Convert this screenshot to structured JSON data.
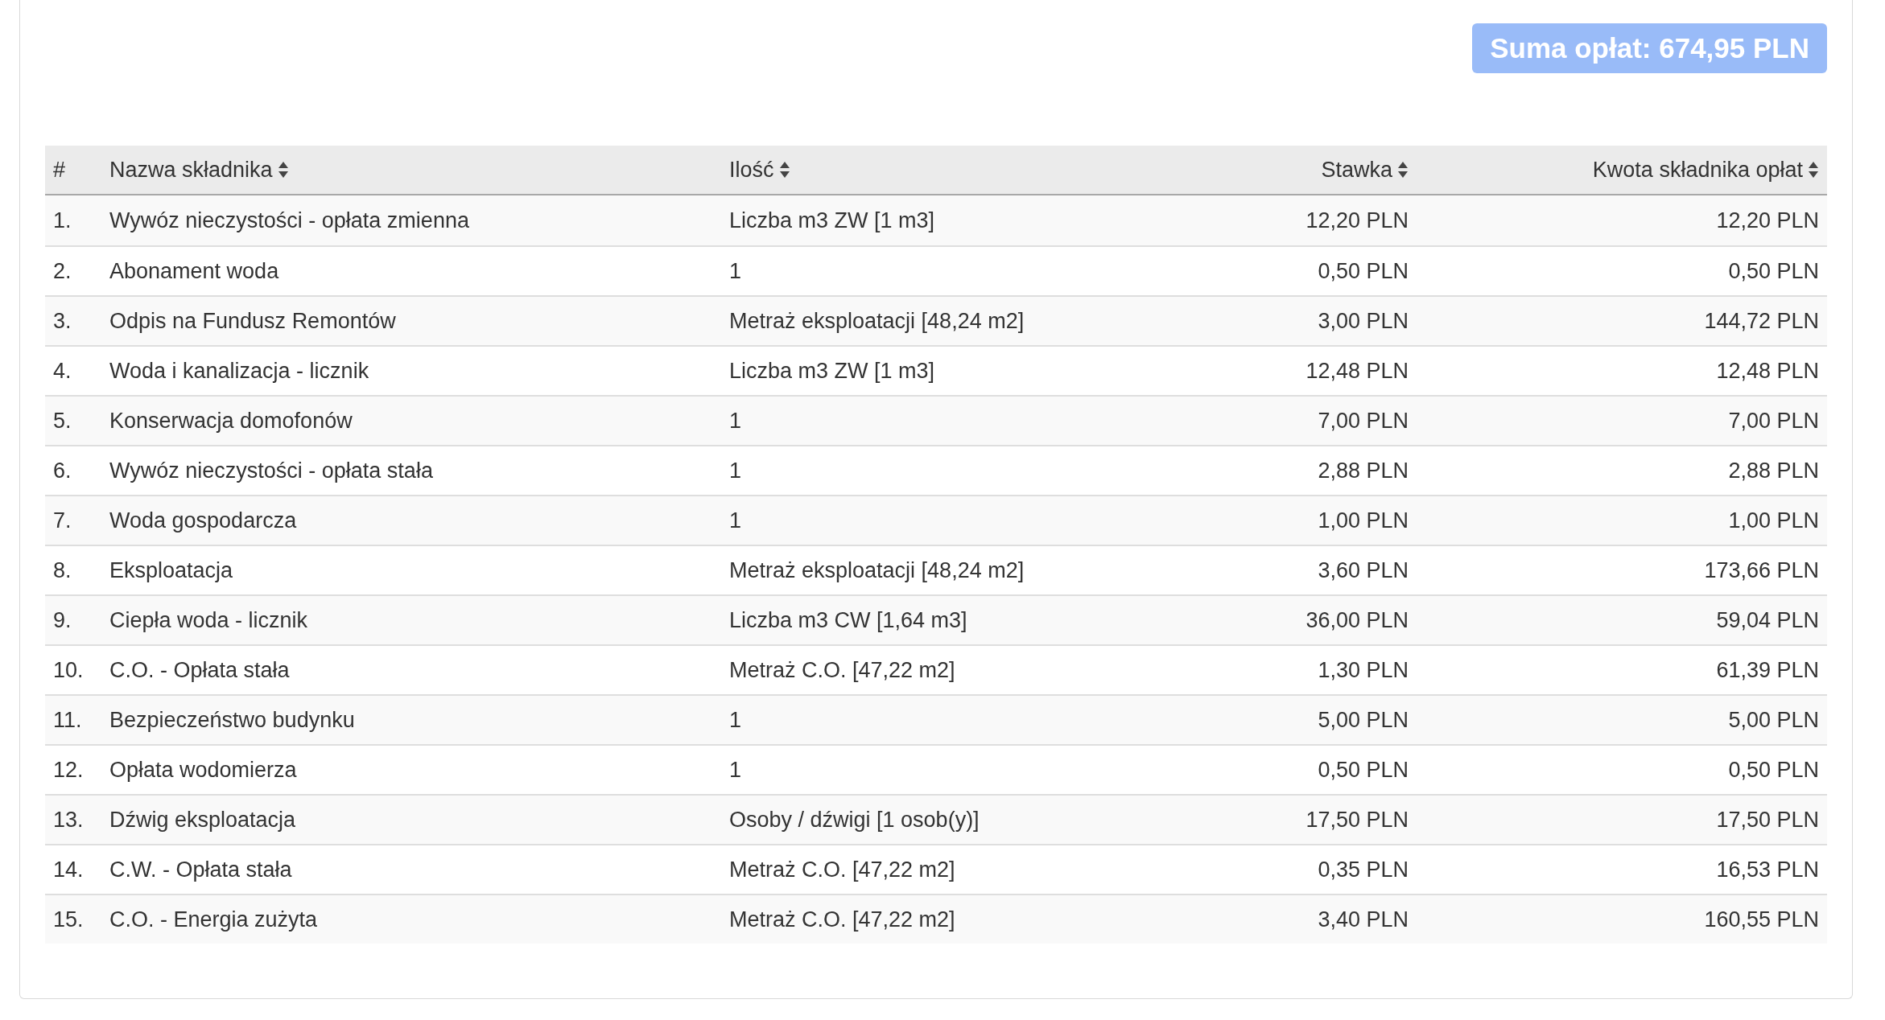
{
  "total_badge": "Suma opłat: 674,95 PLN",
  "table": {
    "columns": [
      {
        "label": "#",
        "sortable": false
      },
      {
        "label": "Nazwa składnika",
        "sortable": true
      },
      {
        "label": "Ilość",
        "sortable": true
      },
      {
        "label": "Stawka",
        "sortable": true
      },
      {
        "label": "Kwota składnika opłat",
        "sortable": true
      }
    ],
    "rows": [
      [
        "1.",
        "Wywóz nieczystości - opłata zmienna",
        "Liczba m3 ZW [1 m3]",
        "12,20 PLN",
        "12,20 PLN"
      ],
      [
        "2.",
        "Abonament woda",
        "1",
        "0,50 PLN",
        "0,50 PLN"
      ],
      [
        "3.",
        "Odpis na Fundusz Remontów",
        "Metraż eksploatacji [48,24 m2]",
        "3,00 PLN",
        "144,72 PLN"
      ],
      [
        "4.",
        "Woda i kanalizacja - licznik",
        "Liczba m3 ZW [1 m3]",
        "12,48 PLN",
        "12,48 PLN"
      ],
      [
        "5.",
        "Konserwacja domofonów",
        "1",
        "7,00 PLN",
        "7,00 PLN"
      ],
      [
        "6.",
        "Wywóz nieczystości - opłata stała",
        "1",
        "2,88 PLN",
        "2,88 PLN"
      ],
      [
        "7.",
        "Woda gospodarcza",
        "1",
        "1,00 PLN",
        "1,00 PLN"
      ],
      [
        "8.",
        "Eksploatacja",
        "Metraż eksploatacji [48,24 m2]",
        "3,60 PLN",
        "173,66 PLN"
      ],
      [
        "9.",
        "Ciepła woda - licznik",
        "Liczba m3 CW [1,64 m3]",
        "36,00 PLN",
        "59,04 PLN"
      ],
      [
        "10.",
        "C.O. - Opłata stała",
        "Metraż C.O. [47,22 m2]",
        "1,30 PLN",
        "61,39 PLN"
      ],
      [
        "11.",
        "Bezpieczeństwo budynku",
        "1",
        "5,00 PLN",
        "5,00 PLN"
      ],
      [
        "12.",
        "Opłata wodomierza",
        "1",
        "0,50 PLN",
        "0,50 PLN"
      ],
      [
        "13.",
        "Dźwig eksploatacja",
        "Osoby / dźwigi [1 osob(y)]",
        "17,50 PLN",
        "17,50 PLN"
      ],
      [
        "14.",
        "C.W. - Opłata stała",
        "Metraż C.O. [47,22 m2]",
        "0,35 PLN",
        "16,53 PLN"
      ],
      [
        "15.",
        "C.O. - Energia zużyta",
        "Metraż C.O. [47,22 m2]",
        "3,40 PLN",
        "160,55 PLN"
      ]
    ]
  }
}
